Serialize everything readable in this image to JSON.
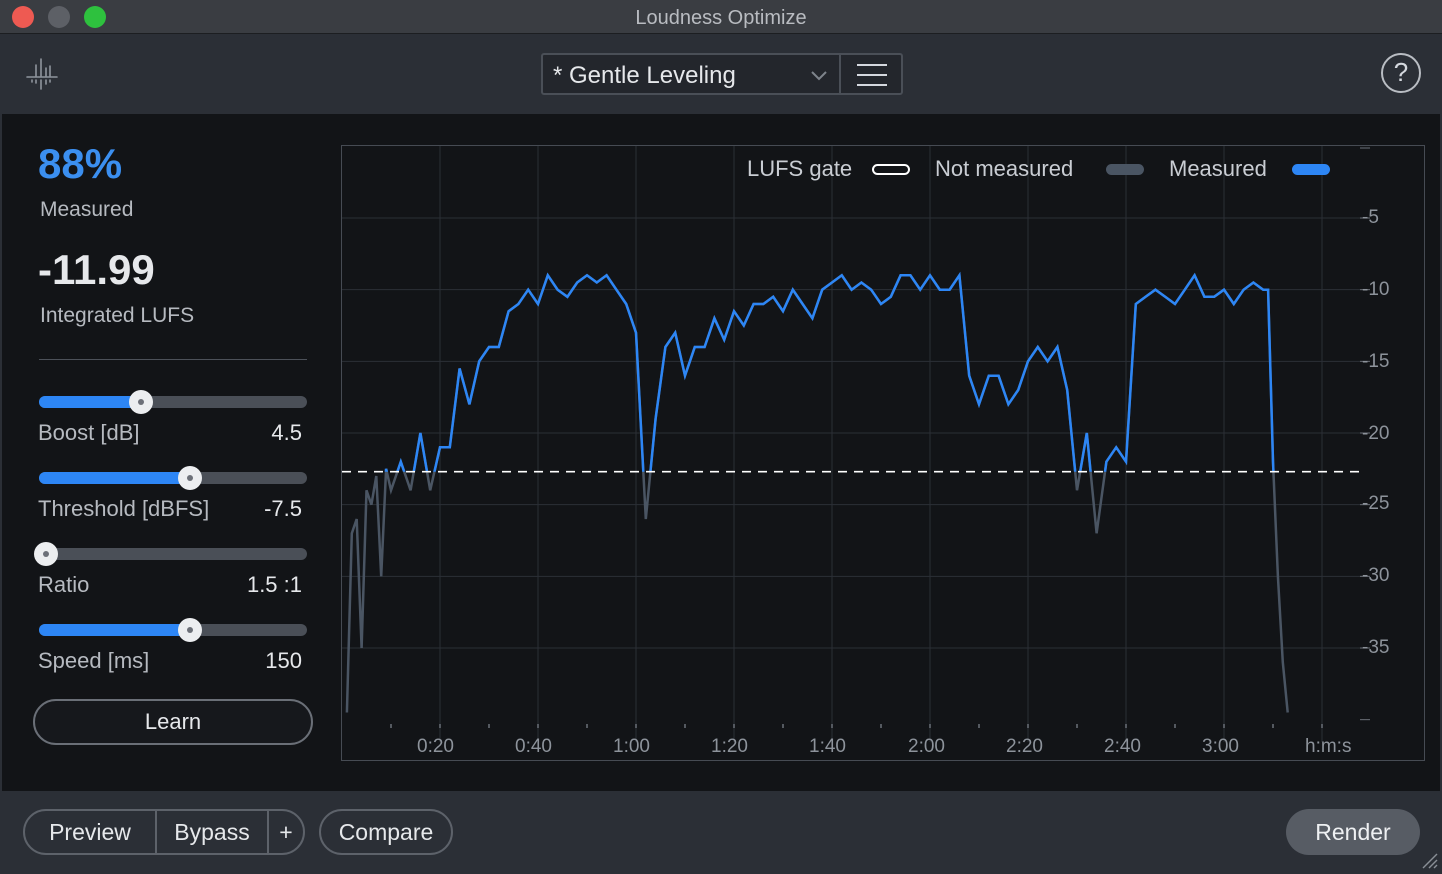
{
  "window": {
    "title": "Loudness Optimize"
  },
  "header": {
    "preset_modified_marker": "*",
    "preset_name": "Gentle Leveling",
    "icons": {
      "logo": "spectrum-meter-icon",
      "menu": "hamburger-menu-icon",
      "help": "question-mark-icon"
    },
    "help_label": "?"
  },
  "stats": {
    "measured_value": "88%",
    "measured_label": "Measured",
    "lufs_value": "-11.99",
    "lufs_label": "Integrated LUFS"
  },
  "controls": {
    "sliders": [
      {
        "label": "Boost [dB]",
        "value": "4.5",
        "fraction": 0.38
      },
      {
        "label": "Threshold [dBFS]",
        "value": "-7.5",
        "fraction": 0.565
      },
      {
        "label": "Ratio",
        "value": "1.5 :1",
        "fraction": 0.025
      },
      {
        "label": "Speed [ms]",
        "value": "150",
        "fraction": 0.565
      }
    ],
    "learn_label": "Learn"
  },
  "footer": {
    "preview_label": "Preview",
    "bypass_label": "Bypass",
    "add_label": "+",
    "compare_label": "Compare",
    "render_label": "Render"
  },
  "colors": {
    "accent": "#2d86f5",
    "measured_line": "#2d86f5",
    "not_measured_line": "#4a5563",
    "gate_line": "#ffffff"
  },
  "chart_data": {
    "type": "line",
    "xlabel": "h:m:s",
    "x_unit_seconds": true,
    "xlim": [
      0,
      200
    ],
    "ylim": [
      -40,
      -3
    ],
    "x_ticks": [
      "0:20",
      "0:40",
      "1:00",
      "1:20",
      "1:40",
      "2:00",
      "2:20",
      "2:40",
      "3:00"
    ],
    "y_ticks": [
      "-5",
      "-10",
      "-15",
      "-20",
      "-25",
      "-30",
      "-35"
    ],
    "gate_level": -22.7,
    "legend": [
      {
        "name": "LUFS gate",
        "style": "outline-white"
      },
      {
        "name": "Not measured",
        "style": "gray"
      },
      {
        "name": "Measured",
        "style": "blue"
      }
    ],
    "series": [
      {
        "x": [
          1,
          2,
          3,
          4,
          5,
          6,
          7,
          8,
          9,
          10,
          12,
          14,
          16,
          18,
          20,
          22,
          24,
          26,
          28,
          30,
          32,
          34,
          36,
          38,
          40,
          42,
          44,
          46,
          48,
          50,
          52,
          54,
          56,
          58,
          60,
          62,
          64,
          66,
          68,
          70,
          72,
          74,
          76,
          78,
          80,
          82,
          84,
          86,
          88,
          90,
          92,
          94,
          96,
          98,
          100,
          102,
          104,
          106,
          108,
          110,
          112,
          114,
          116,
          118,
          120,
          122,
          124,
          126,
          128,
          130,
          132,
          134,
          136,
          138,
          140,
          142,
          144,
          146,
          148,
          150,
          152,
          154,
          156,
          158,
          160,
          162,
          164,
          166,
          168,
          170,
          172,
          174,
          176,
          178,
          180,
          182,
          184,
          186,
          188,
          189,
          190,
          191,
          192,
          193
        ],
        "y": [
          -39.5,
          -27,
          -26,
          -35,
          -24,
          -25,
          -23,
          -30,
          -22.5,
          -24,
          -22,
          -24,
          -20,
          -24,
          -21,
          -21,
          -15.5,
          -18,
          -15,
          -14,
          -14,
          -11.5,
          -11,
          -10,
          -11,
          -9,
          -10,
          -10.5,
          -9.5,
          -9,
          -9.5,
          -9,
          -10,
          -11,
          -13,
          -26,
          -19,
          -14,
          -13,
          -16,
          -14,
          -14,
          -12,
          -13.5,
          -11.5,
          -12.5,
          -11,
          -11,
          -10.5,
          -11.5,
          -10,
          -11,
          -12,
          -10,
          -9.5,
          -9,
          -10,
          -9.5,
          -10,
          -11,
          -10.5,
          -9,
          -9,
          -10,
          -9,
          -10,
          -10,
          -9,
          -16,
          -18,
          -16,
          -16,
          -18,
          -17,
          -15,
          -14,
          -15,
          -14,
          -17,
          -24,
          -20,
          -27,
          -22,
          -21,
          -22,
          -11,
          -10.5,
          -10,
          -10.5,
          -11,
          -10,
          -9,
          -10.5,
          -10.5,
          -10,
          -11,
          -10,
          -9.5,
          -10,
          -10,
          -22,
          -30,
          -36,
          -39.5
        ],
        "measured_from_index": 0
      }
    ]
  }
}
